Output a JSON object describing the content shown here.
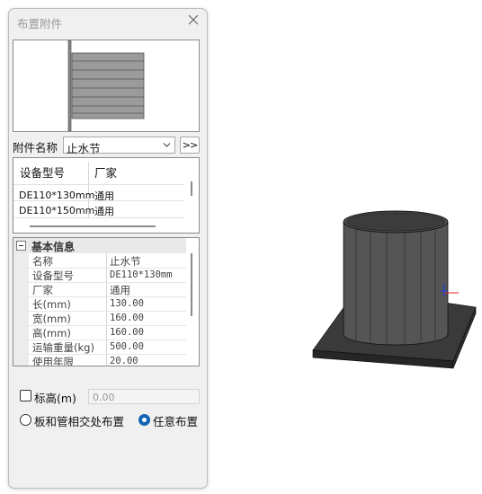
{
  "dialog": {
    "title": "布置附件",
    "close_icon": "close-icon"
  },
  "fitting": {
    "label": "附件名称",
    "selected": "止水节",
    "more_label": ">>"
  },
  "models": {
    "columns": [
      "设备型号",
      "厂家"
    ],
    "rows": [
      [
        "DE110*130mm",
        "通用"
      ],
      [
        "DE110*150mm",
        "通用"
      ]
    ]
  },
  "properties": {
    "section_title": "基本信息",
    "rows": [
      [
        "名称",
        "止水节"
      ],
      [
        "设备型号",
        "DE110*130mm"
      ],
      [
        "厂家",
        "通用"
      ],
      [
        "长(mm)",
        "130.00"
      ],
      [
        "宽(mm)",
        "160.00"
      ],
      [
        "高(mm)",
        "160.00"
      ],
      [
        "运输重量(kg)",
        "500.00"
      ],
      [
        "使用年限",
        "20.00"
      ]
    ]
  },
  "elevation": {
    "label": "标高(m)",
    "value": "0.00",
    "checked": false
  },
  "placement": {
    "option_intersection": "板和管相交处布置",
    "option_free": "任意布置",
    "selected": "任意布置"
  },
  "colors": {
    "accent": "#1164b5",
    "model_fill": "#555555"
  }
}
